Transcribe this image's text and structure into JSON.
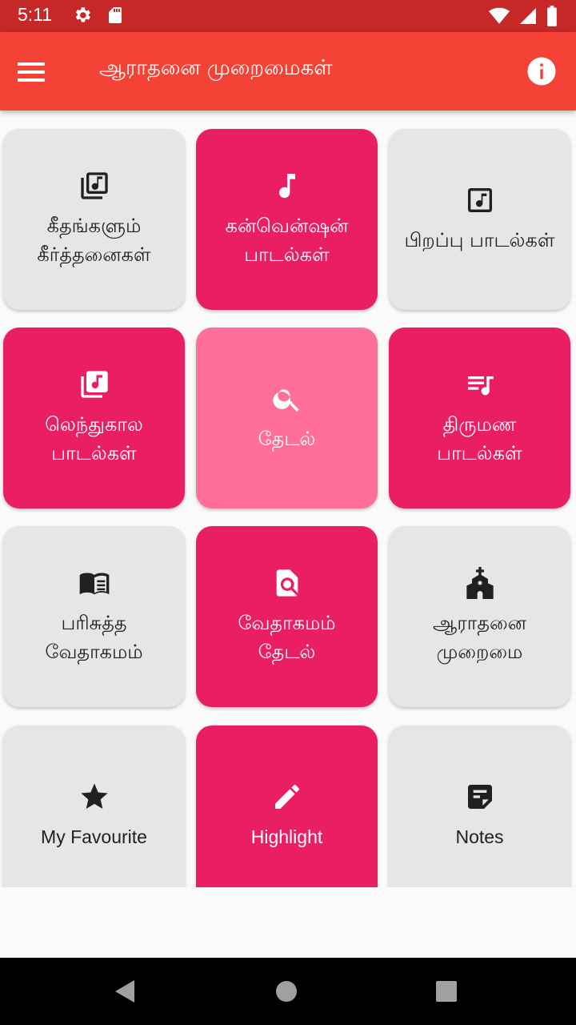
{
  "status_bar": {
    "time": "5:11",
    "icons": [
      "settings-icon",
      "sd-card-icon",
      "wifi-icon",
      "signal-icon",
      "battery-icon"
    ]
  },
  "app_bar": {
    "title": "ஆராதனை முறைமைகள்",
    "menu_icon": "menu-icon",
    "info_icon": "info-icon"
  },
  "tiles": [
    {
      "line1": "கீதங்களும்",
      "line2": "கீர்த்தனைகள்",
      "icon": "library-music-icon",
      "color": "gray"
    },
    {
      "line1": "கன்வென்ஷன்",
      "line2": "பாடல்கள்",
      "icon": "music-note-icon",
      "color": "pink"
    },
    {
      "line1": "பிறப்பு பாடல்கள்",
      "line2": "",
      "icon": "music-box-icon",
      "color": "gray"
    },
    {
      "line1": "லெந்துகால",
      "line2": "பாடல்கள்",
      "icon": "library-music-icon",
      "color": "pink"
    },
    {
      "line1": "தேடல்",
      "line2": "",
      "icon": "search-icon",
      "color": "light"
    },
    {
      "line1": "திருமண",
      "line2": "பாடல்கள்",
      "icon": "queue-music-icon",
      "color": "pink"
    },
    {
      "line1": "பரிசுத்த",
      "line2": "வேதாகமம்",
      "icon": "book-icon",
      "color": "gray"
    },
    {
      "line1": "வேதாகமம்",
      "line2": "தேடல்",
      "icon": "find-in-page-icon",
      "color": "pink"
    },
    {
      "line1": "ஆராதனை",
      "line2": "முறைமை",
      "icon": "church-icon",
      "color": "gray"
    },
    {
      "line1": "My Favourite",
      "line2": "",
      "icon": "star-icon",
      "color": "gray"
    },
    {
      "line1": "Highlight",
      "line2": "",
      "icon": "pencil-icon",
      "color": "pink"
    },
    {
      "line1": "Notes",
      "line2": "",
      "icon": "note-icon",
      "color": "gray"
    }
  ],
  "nav_bar": {
    "back_icon": "back-triangle-icon",
    "home_icon": "home-circle-icon",
    "recents_icon": "recents-square-icon"
  },
  "colors": {
    "status_bar": "#c62828",
    "app_bar": "#f44336",
    "tile_pink": "#e91e63",
    "tile_light_pink": "#ff6f9a",
    "tile_gray": "#e6e6e6"
  }
}
